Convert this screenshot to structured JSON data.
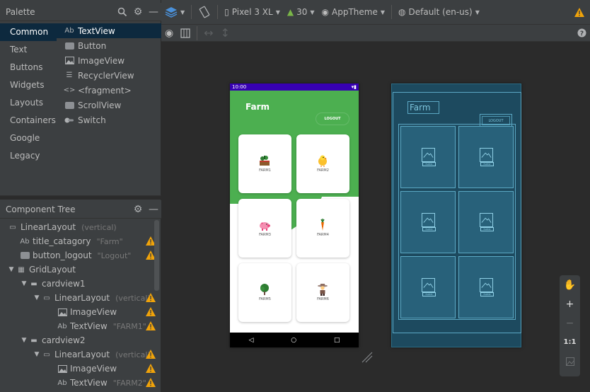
{
  "palette": {
    "title": "Palette",
    "categories": [
      "Common",
      "Text",
      "Buttons",
      "Widgets",
      "Layouts",
      "Containers",
      "Google",
      "Legacy"
    ],
    "widgets": [
      {
        "icon": "textview-icon",
        "prefix": "Ab",
        "label": "TextView"
      },
      {
        "icon": "button-icon",
        "prefix": "",
        "label": "Button"
      },
      {
        "icon": "imageview-icon",
        "prefix": "",
        "label": "ImageView"
      },
      {
        "icon": "recyclerview-icon",
        "prefix": "",
        "label": "RecyclerView"
      },
      {
        "icon": "fragment-icon",
        "prefix": "",
        "label": "<fragment>"
      },
      {
        "icon": "scrollview-icon",
        "prefix": "",
        "label": "ScrollView"
      },
      {
        "icon": "switch-icon",
        "prefix": "",
        "label": "Switch"
      }
    ]
  },
  "tree": {
    "title": "Component Tree",
    "nodes": [
      {
        "label": "LinearLayout",
        "meta": "(vertical)",
        "warn": false
      },
      {
        "prefix": "Ab",
        "label": "title_catagory",
        "meta": "\"Farm\"",
        "warn": true
      },
      {
        "label": "button_logout",
        "meta": "\"Logout\"",
        "warn": true
      },
      {
        "label": "GridLayout",
        "meta": "",
        "warn": false
      },
      {
        "label": "cardview1",
        "meta": "",
        "warn": false
      },
      {
        "label": "LinearLayout",
        "meta": "(vertical)",
        "warn": true
      },
      {
        "label": "ImageView",
        "meta": "",
        "warn": true
      },
      {
        "prefix": "Ab",
        "label": "TextView",
        "meta": "\"FARM1\"",
        "warn": true
      },
      {
        "label": "cardview2",
        "meta": "",
        "warn": false
      },
      {
        "label": "LinearLayout",
        "meta": "(vertical)",
        "warn": true
      },
      {
        "label": "ImageView",
        "meta": "",
        "warn": true
      },
      {
        "prefix": "Ab",
        "label": "TextView",
        "meta": "\"FARM2\"",
        "warn": true
      }
    ]
  },
  "toolbar": {
    "device": "Pixel 3 XL",
    "api": "30",
    "theme": "AppTheme",
    "locale": "Default (en-us)"
  },
  "phone": {
    "time": "10:00",
    "title": "Farm",
    "logout": "LOGOUT",
    "cards": [
      "FARM1",
      "FARM2",
      "FARM3",
      "FARM4",
      "FARM5",
      "FARM6"
    ],
    "nav_back": "◁",
    "nav_home": "○",
    "nav_recent": "□"
  },
  "blueprint": {
    "title": "Farm",
    "logout": "LOGOUT",
    "cards": [
      "FARM1",
      "FARM2",
      "FARM3",
      "FARM4",
      "FARM5",
      "FARM6"
    ]
  },
  "zoom": {
    "plus": "+",
    "minus": "−",
    "one_to_one": "1:1"
  },
  "colors": {
    "green": "#4caf50",
    "status_purple": "#3700b3",
    "blueprint": "#1d4a5f",
    "warning": "#f0a30a"
  }
}
